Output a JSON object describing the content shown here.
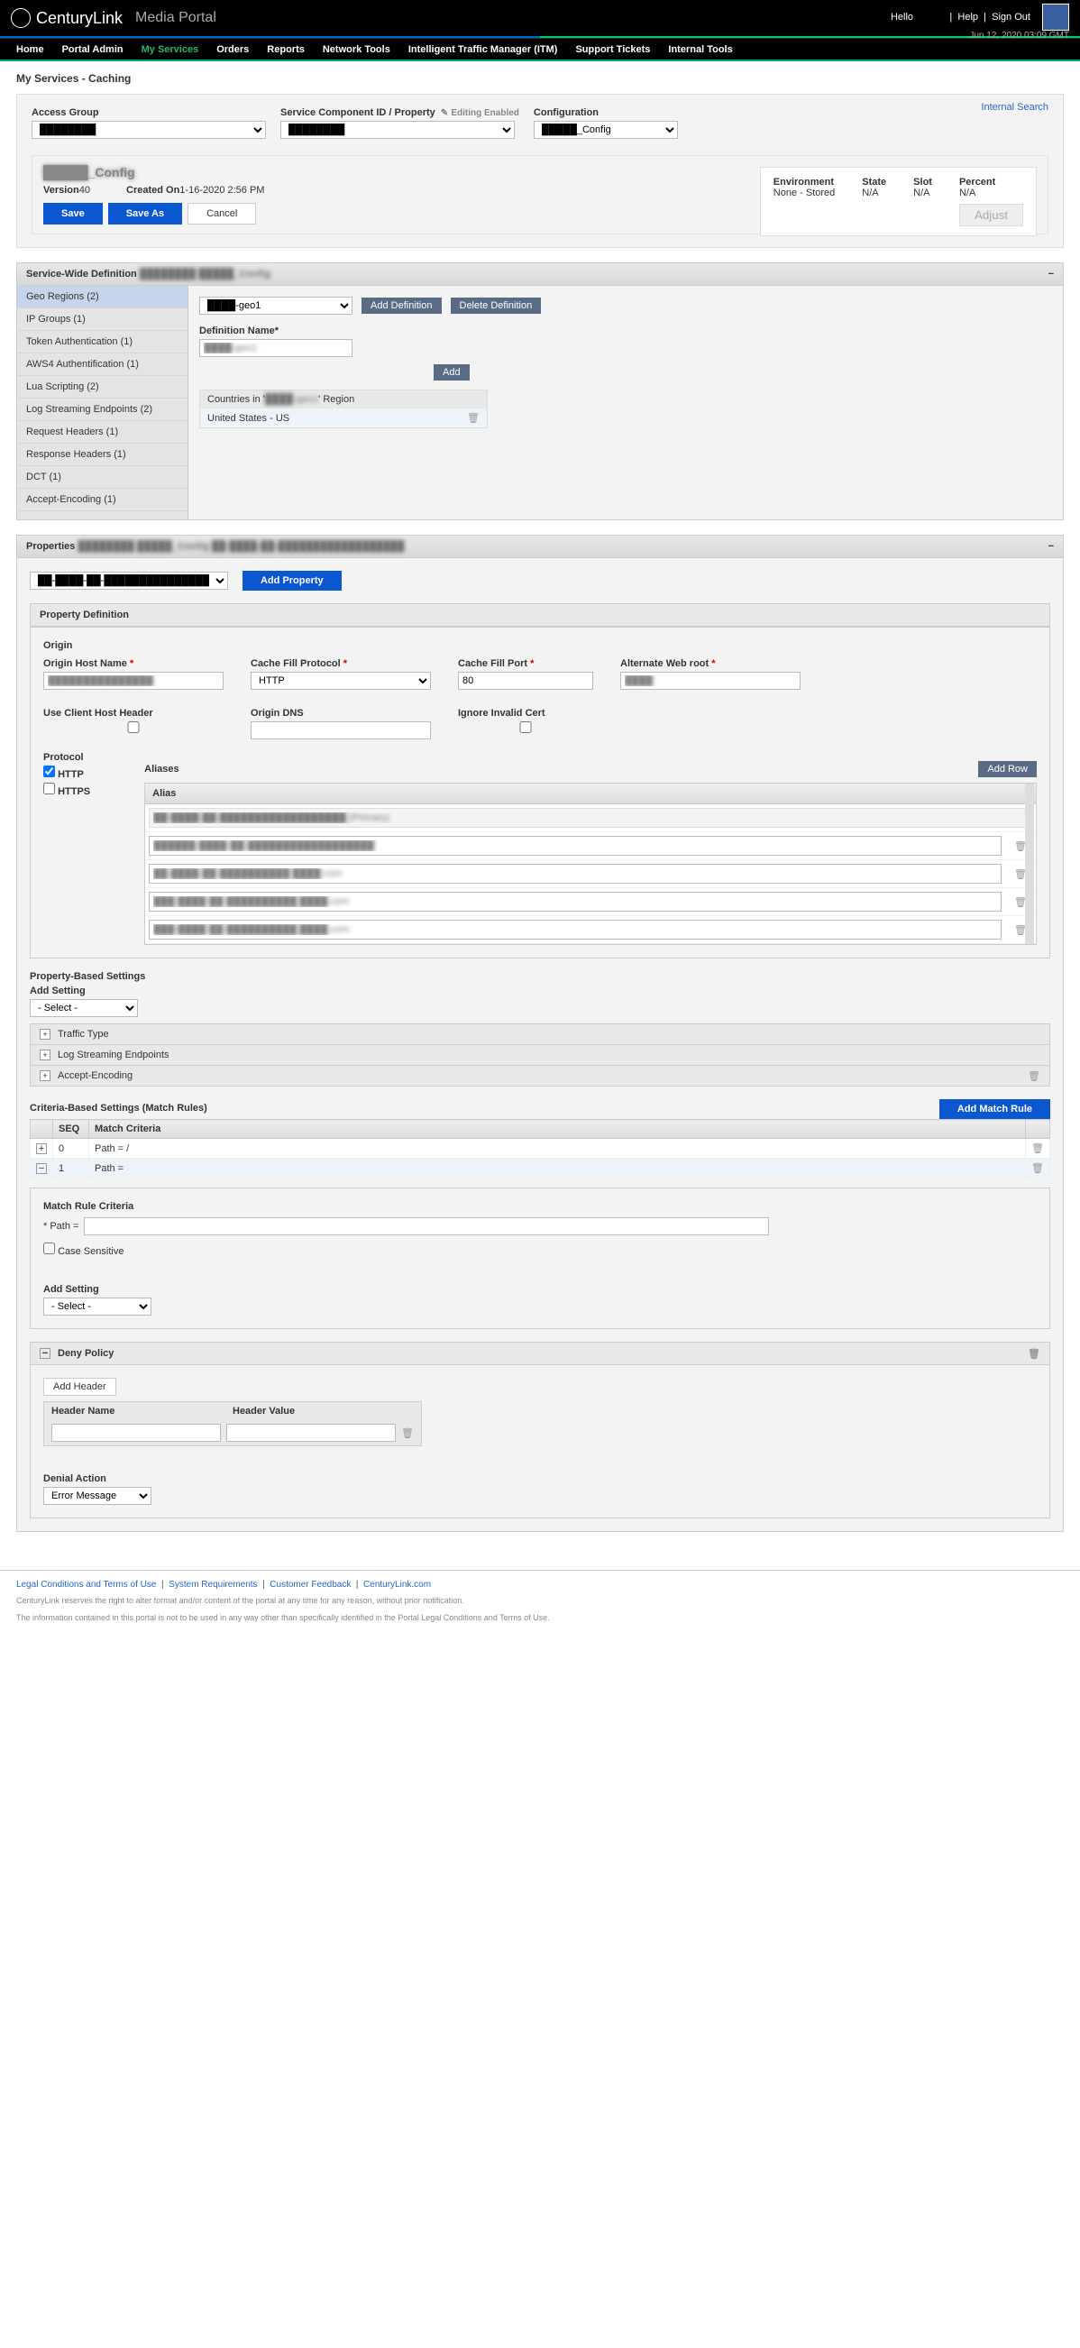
{
  "header": {
    "brand": "CenturyLink",
    "brand_sub": "Media Portal",
    "hello": "Hello",
    "user": "████",
    "help": "Help",
    "signout": "Sign Out",
    "date": "Jun 12, 2020 03:09 GMT"
  },
  "menu": [
    "Home",
    "Portal Admin",
    "My Services",
    "Orders",
    "Reports",
    "Network Tools",
    "Intelligent Traffic Manager (ITM)",
    "Support Tickets",
    "Internal Tools"
  ],
  "menu_active_index": 2,
  "page_title": "My Services - Caching",
  "internal_search": "Internal Search",
  "filters": {
    "access_group_label": "Access Group",
    "access_group_value": "████████",
    "scid_label": "Service Component ID / Property",
    "scid_hint": "Editing Enabled",
    "scid_value": "████████",
    "config_label": "Configuration",
    "config_value": "█████_Config"
  },
  "config": {
    "name": "█████_Config",
    "version_label": "Version",
    "version": "40",
    "created_label": "Created On",
    "created": "1-16-2020 2:56 PM",
    "save": "Save",
    "saveas": "Save As",
    "cancel": "Cancel",
    "env": {
      "environment_l": "Environment",
      "environment_v": "None - Stored",
      "state_l": "State",
      "state_v": "N/A",
      "slot_l": "Slot",
      "slot_v": "N/A",
      "percent_l": "Percent",
      "percent_v": "N/A",
      "adjust": "Adjust"
    }
  },
  "swd": {
    "title": "Service-Wide Definition",
    "title_suffix": "████████  █████_Config",
    "tabs": [
      "Geo Regions (2)",
      "IP Groups (1)",
      "Token Authentication (1)",
      "AWS4 Authentification (1)",
      "Lua Scripting (2)",
      "Log Streaming Endpoints (2)",
      "Request Headers (1)",
      "Response Headers (1)",
      "DCT (1)",
      "Accept-Encoding (1)"
    ],
    "active_tab": 0,
    "definition_select": "████-geo1",
    "add_def": "Add Definition",
    "del_def": "Delete Definition",
    "def_name_label": "Definition Name*",
    "def_name_value": "████-geo1",
    "add": "Add",
    "countries_label": "Countries in '████-geo1' Region",
    "country": "United States - US"
  },
  "props": {
    "title": "Properties",
    "title_suffix": "████████  █████_Config  ██-████-██-██████████████████",
    "select_value": "██-████-██-██████████████████",
    "add_property": "Add Property"
  },
  "propdef": {
    "title": "Property Definition",
    "origin_title": "Origin",
    "ohn_label": "Origin Host Name",
    "ohn_value": "███████████████",
    "cfp_label": "Cache Fill Protocol",
    "cfp_value": "HTTP",
    "cfport_label": "Cache Fill Port",
    "cfport_value": "80",
    "awr_label": "Alternate Web root",
    "awr_value": "████",
    "uchh_label": "Use Client Host Header",
    "odns_label": "Origin DNS",
    "odns_value": "",
    "iic_label": "Ignore Invalid Cert",
    "protocol_label": "Protocol",
    "http": "HTTP",
    "https": "HTTPS",
    "aliases_label": "Aliases",
    "add_row": "Add Row",
    "alias_col": "Alias",
    "aliases": [
      "██-████-██-██████████████████ (Primary)",
      "██████-████-██-██████████████████",
      "██-████-██-██████████.████.com",
      "███-████-██-██████████.████.com",
      "███-████-██-██████████.████.com"
    ]
  },
  "pbs": {
    "title": "Property-Based Settings",
    "add_setting_label": "Add Setting",
    "select": "- Select -",
    "rows": [
      "Traffic Type",
      "Log Streaming Endpoints",
      "Accept-Encoding"
    ]
  },
  "cbs": {
    "title": "Criteria-Based Settings (Match Rules)",
    "add_match": "Add Match Rule",
    "cols": {
      "seq": "SEQ",
      "mc": "Match Criteria"
    },
    "rows": [
      {
        "exp": "+",
        "seq": "0",
        "mc": "Path = /"
      },
      {
        "exp": "−",
        "seq": "1",
        "mc": "Path ="
      }
    ],
    "mrc_title": "Match Rule Criteria",
    "path_label": "* Path =",
    "case_label": "Case Sensitive",
    "add_setting_label": "Add Setting",
    "select": "- Select -"
  },
  "deny": {
    "title": "Deny Policy",
    "add_header": "Add Header",
    "hn": "Header Name",
    "hv": "Header Value",
    "da_label": "Denial Action",
    "da_value": "Error Message"
  },
  "footer": {
    "links": [
      "Legal Conditions and Terms of Use",
      "System Requirements",
      "Customer Feedback",
      "CenturyLink.com"
    ],
    "d1": "CenturyLink reserves the right to alter format and/or content of the portal at any time for any reason, without prior notification.",
    "d2": "The information contained in this portal is not to be used in any way other than specifically identified in the Portal Legal Conditions and Terms of Use."
  }
}
